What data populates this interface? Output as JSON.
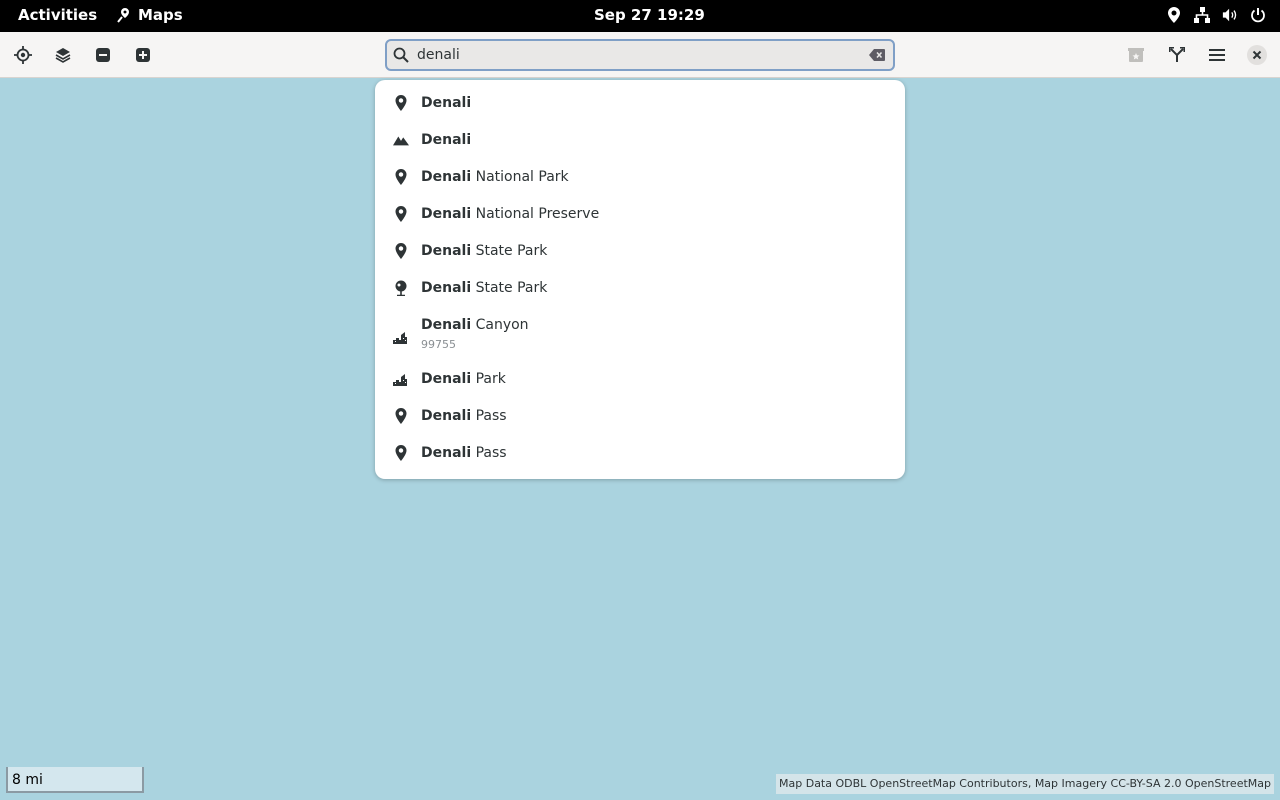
{
  "topbar": {
    "activities": "Activities",
    "app_name": "Maps",
    "clock": "Sep 27  19:29",
    "tray_icons": [
      "location-icon",
      "network-icon",
      "volume-icon",
      "power-icon"
    ]
  },
  "header": {
    "left_buttons": [
      "locate-icon",
      "layers-icon",
      "zoom-out-icon",
      "zoom-in-icon"
    ],
    "search_value": "denali",
    "right_buttons": [
      "favorites-icon",
      "route-icon",
      "menu-icon",
      "close-icon"
    ]
  },
  "results": [
    {
      "icon": "pin-icon",
      "bold": "Denali",
      "rest": "",
      "sub": ""
    },
    {
      "icon": "mountain-icon",
      "bold": "Denali",
      "rest": "",
      "sub": ""
    },
    {
      "icon": "pin-icon",
      "bold": "Denali",
      "rest": " National Park",
      "sub": ""
    },
    {
      "icon": "pin-icon",
      "bold": "Denali",
      "rest": " National Preserve",
      "sub": ""
    },
    {
      "icon": "pin-icon",
      "bold": "Denali",
      "rest": " State Park",
      "sub": ""
    },
    {
      "icon": "park-icon",
      "bold": "Denali",
      "rest": " State Park",
      "sub": ""
    },
    {
      "icon": "town-icon",
      "bold": "Denali",
      "rest": " Canyon",
      "sub": "99755"
    },
    {
      "icon": "town-icon",
      "bold": "Denali",
      "rest": " Park",
      "sub": ""
    },
    {
      "icon": "pin-icon",
      "bold": "Denali",
      "rest": " Pass",
      "sub": ""
    },
    {
      "icon": "pin-icon",
      "bold": "Denali",
      "rest": " Pass",
      "sub": ""
    }
  ],
  "map": {
    "scale": "8 mi",
    "attribution": "Map Data ODBL OpenStreetMap Contributors, Map Imagery CC-BY-SA 2.0 OpenStreetMap",
    "water_color": "#aad3df"
  }
}
